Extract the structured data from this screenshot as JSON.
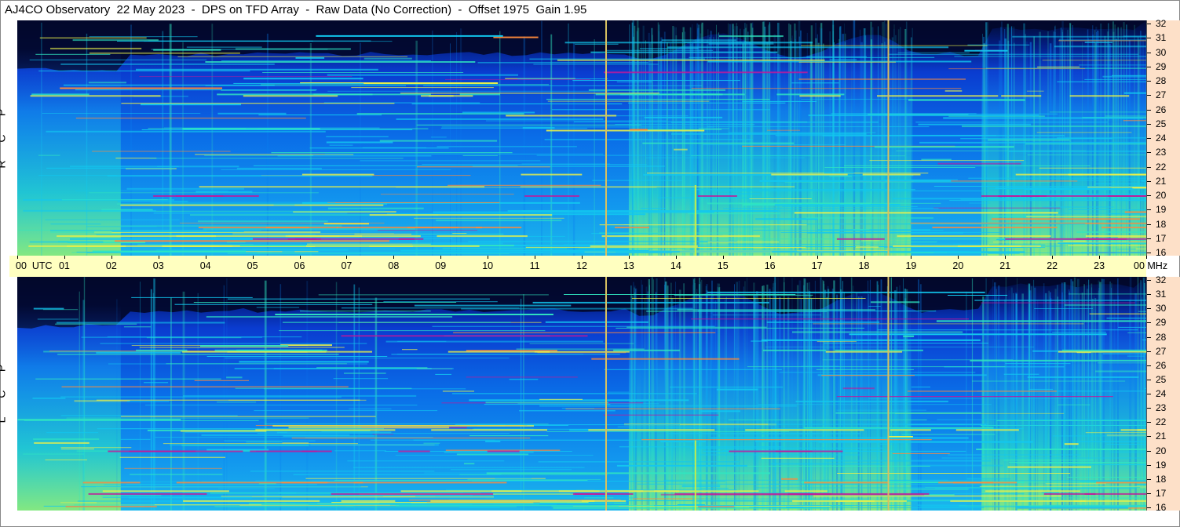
{
  "title": "AJ4CO Observatory  22 May 2023  -  DPS on TFD Array  -  Raw Data (No Correction)  -  Offset 1975  Gain 1.95",
  "panels": {
    "rcp": {
      "side_letters": [
        "P",
        "C",
        "R"
      ]
    },
    "lcp": {
      "side_letters": [
        "P",
        "C",
        "L"
      ]
    }
  },
  "colors": {
    "background": "#ffffff",
    "time_axis_bg": "#ffffc0",
    "freq_axis_bg": "#fde0c8",
    "colormap": [
      "#02104f",
      "#0a3fd8",
      "#0a7ff0",
      "#12c8f0",
      "#30e6c0",
      "#e8f04a",
      "#ff8a3a",
      "#c2189a"
    ]
  },
  "chart_data": [
    {
      "type": "heatmap",
      "panel": "RCP",
      "x_axis": "Time (UTC)",
      "y_axis": "Frequency (MHz)",
      "xlim": [
        0,
        24
      ],
      "ylim": [
        16,
        32
      ],
      "x_ticks": [
        "00  UTC",
        "01",
        "02",
        "03",
        "04",
        "05",
        "06",
        "07",
        "08",
        "09",
        "10",
        "11",
        "12",
        "13",
        "14",
        "15",
        "16",
        "17",
        "18",
        "19",
        "20",
        "21",
        "22",
        "23",
        "00 MHz"
      ],
      "y_ticks": [
        16,
        17,
        18,
        19,
        20,
        21,
        22,
        23,
        24,
        25,
        26,
        27,
        28,
        29,
        30,
        31,
        32
      ],
      "vertical_markers_utc": [
        12.5,
        18.5
      ],
      "intensity_regions_utc": [
        [
          0,
          2.2
        ],
        [
          13.0,
          19.0
        ],
        [
          20.5,
          24
        ]
      ]
    },
    {
      "type": "heatmap",
      "panel": "LCP",
      "x_axis": "Time (UTC)",
      "y_axis": "Frequency (MHz)",
      "xlim": [
        0,
        24
      ],
      "ylim": [
        16,
        32
      ],
      "y_ticks": [
        16,
        17,
        18,
        19,
        20,
        21,
        22,
        23,
        24,
        25,
        26,
        27,
        28,
        29,
        30,
        31,
        32
      ],
      "vertical_markers_utc": [
        12.5,
        18.5
      ],
      "intensity_regions_utc": [
        [
          0,
          2.2
        ],
        [
          13.0,
          19.0
        ],
        [
          20.5,
          24
        ]
      ]
    }
  ]
}
